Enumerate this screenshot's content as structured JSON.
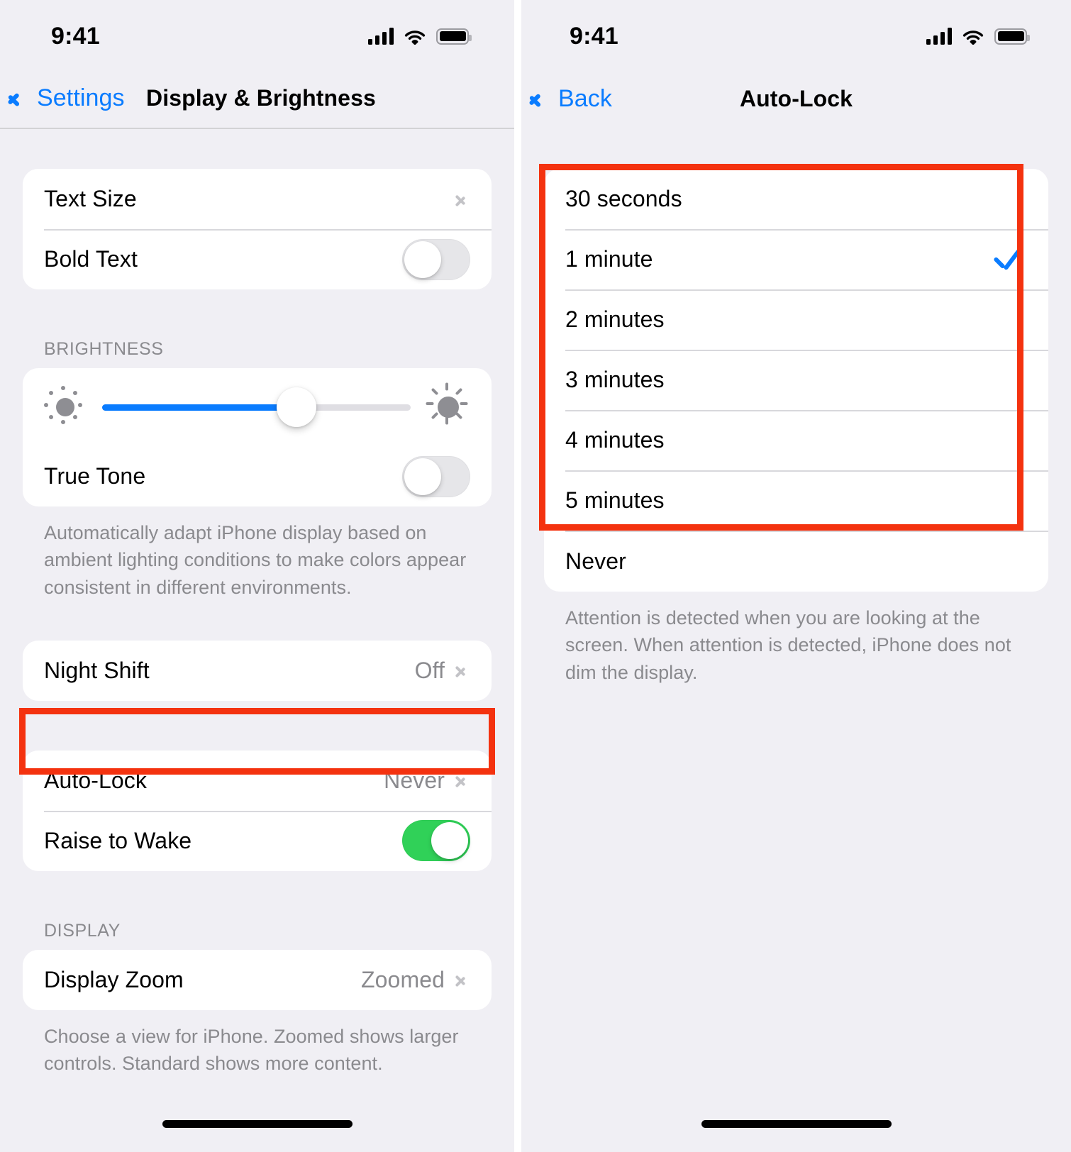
{
  "status_bar": {
    "time": "9:41",
    "cellular_icon": "cellular-bars-icon",
    "wifi_icon": "wifi-icon",
    "battery_icon": "battery-full-icon"
  },
  "left_screen": {
    "nav": {
      "back_label": "Settings",
      "title": "Display & Brightness"
    },
    "group_text": {
      "rows": [
        {
          "label": "Text Size",
          "value": "",
          "accessory": "chevron"
        },
        {
          "label": "Bold Text",
          "value": "",
          "accessory": "toggle-off"
        }
      ]
    },
    "brightness": {
      "header": "BRIGHTNESS",
      "slider": {
        "value_percent": 63,
        "min_icon": "sun-small-icon",
        "max_icon": "sun-large-icon",
        "fill_color": "#0A7CFF",
        "track_color": "#DFDEE3"
      },
      "true_tone": {
        "label": "True Tone",
        "accessory": "toggle-off"
      },
      "footer": "Automatically adapt iPhone display based on ambient lighting conditions to make colors appear consistent in different environments."
    },
    "night_shift": {
      "label": "Night Shift",
      "value": "Off",
      "accessory": "chevron"
    },
    "autolock_group": {
      "rows": [
        {
          "label": "Auto-Lock",
          "value": "Never",
          "accessory": "chevron",
          "highlighted": true
        },
        {
          "label": "Raise to Wake",
          "value": "",
          "accessory": "toggle-on"
        }
      ]
    },
    "display": {
      "header": "DISPLAY",
      "row": {
        "label": "Display Zoom",
        "value": "Zoomed",
        "accessory": "chevron"
      },
      "footer": "Choose a view for iPhone. Zoomed shows larger controls. Standard shows more content."
    }
  },
  "right_screen": {
    "nav": {
      "back_label": "Back",
      "title": "Auto-Lock"
    },
    "options": [
      {
        "label": "30 seconds",
        "selected": false
      },
      {
        "label": "1 minute",
        "selected": true
      },
      {
        "label": "2 minutes",
        "selected": false
      },
      {
        "label": "3 minutes",
        "selected": false
      },
      {
        "label": "4 minutes",
        "selected": false
      },
      {
        "label": "5 minutes",
        "selected": false
      },
      {
        "label": "Never",
        "selected": false
      }
    ],
    "selected_value": "1 minute",
    "footer": "Attention is detected when you are looking at the screen. When attention is detected, iPhone does not dim the display."
  },
  "annotation": {
    "highlight_color": "#F4320F",
    "highlight_count": 3
  },
  "theme": {
    "background": "#F0EFF4",
    "card": "#FFFFFF",
    "accent_blue": "#0A7CFF",
    "toggle_on_green": "#30D158",
    "secondary_text": "#8A8A8E"
  }
}
